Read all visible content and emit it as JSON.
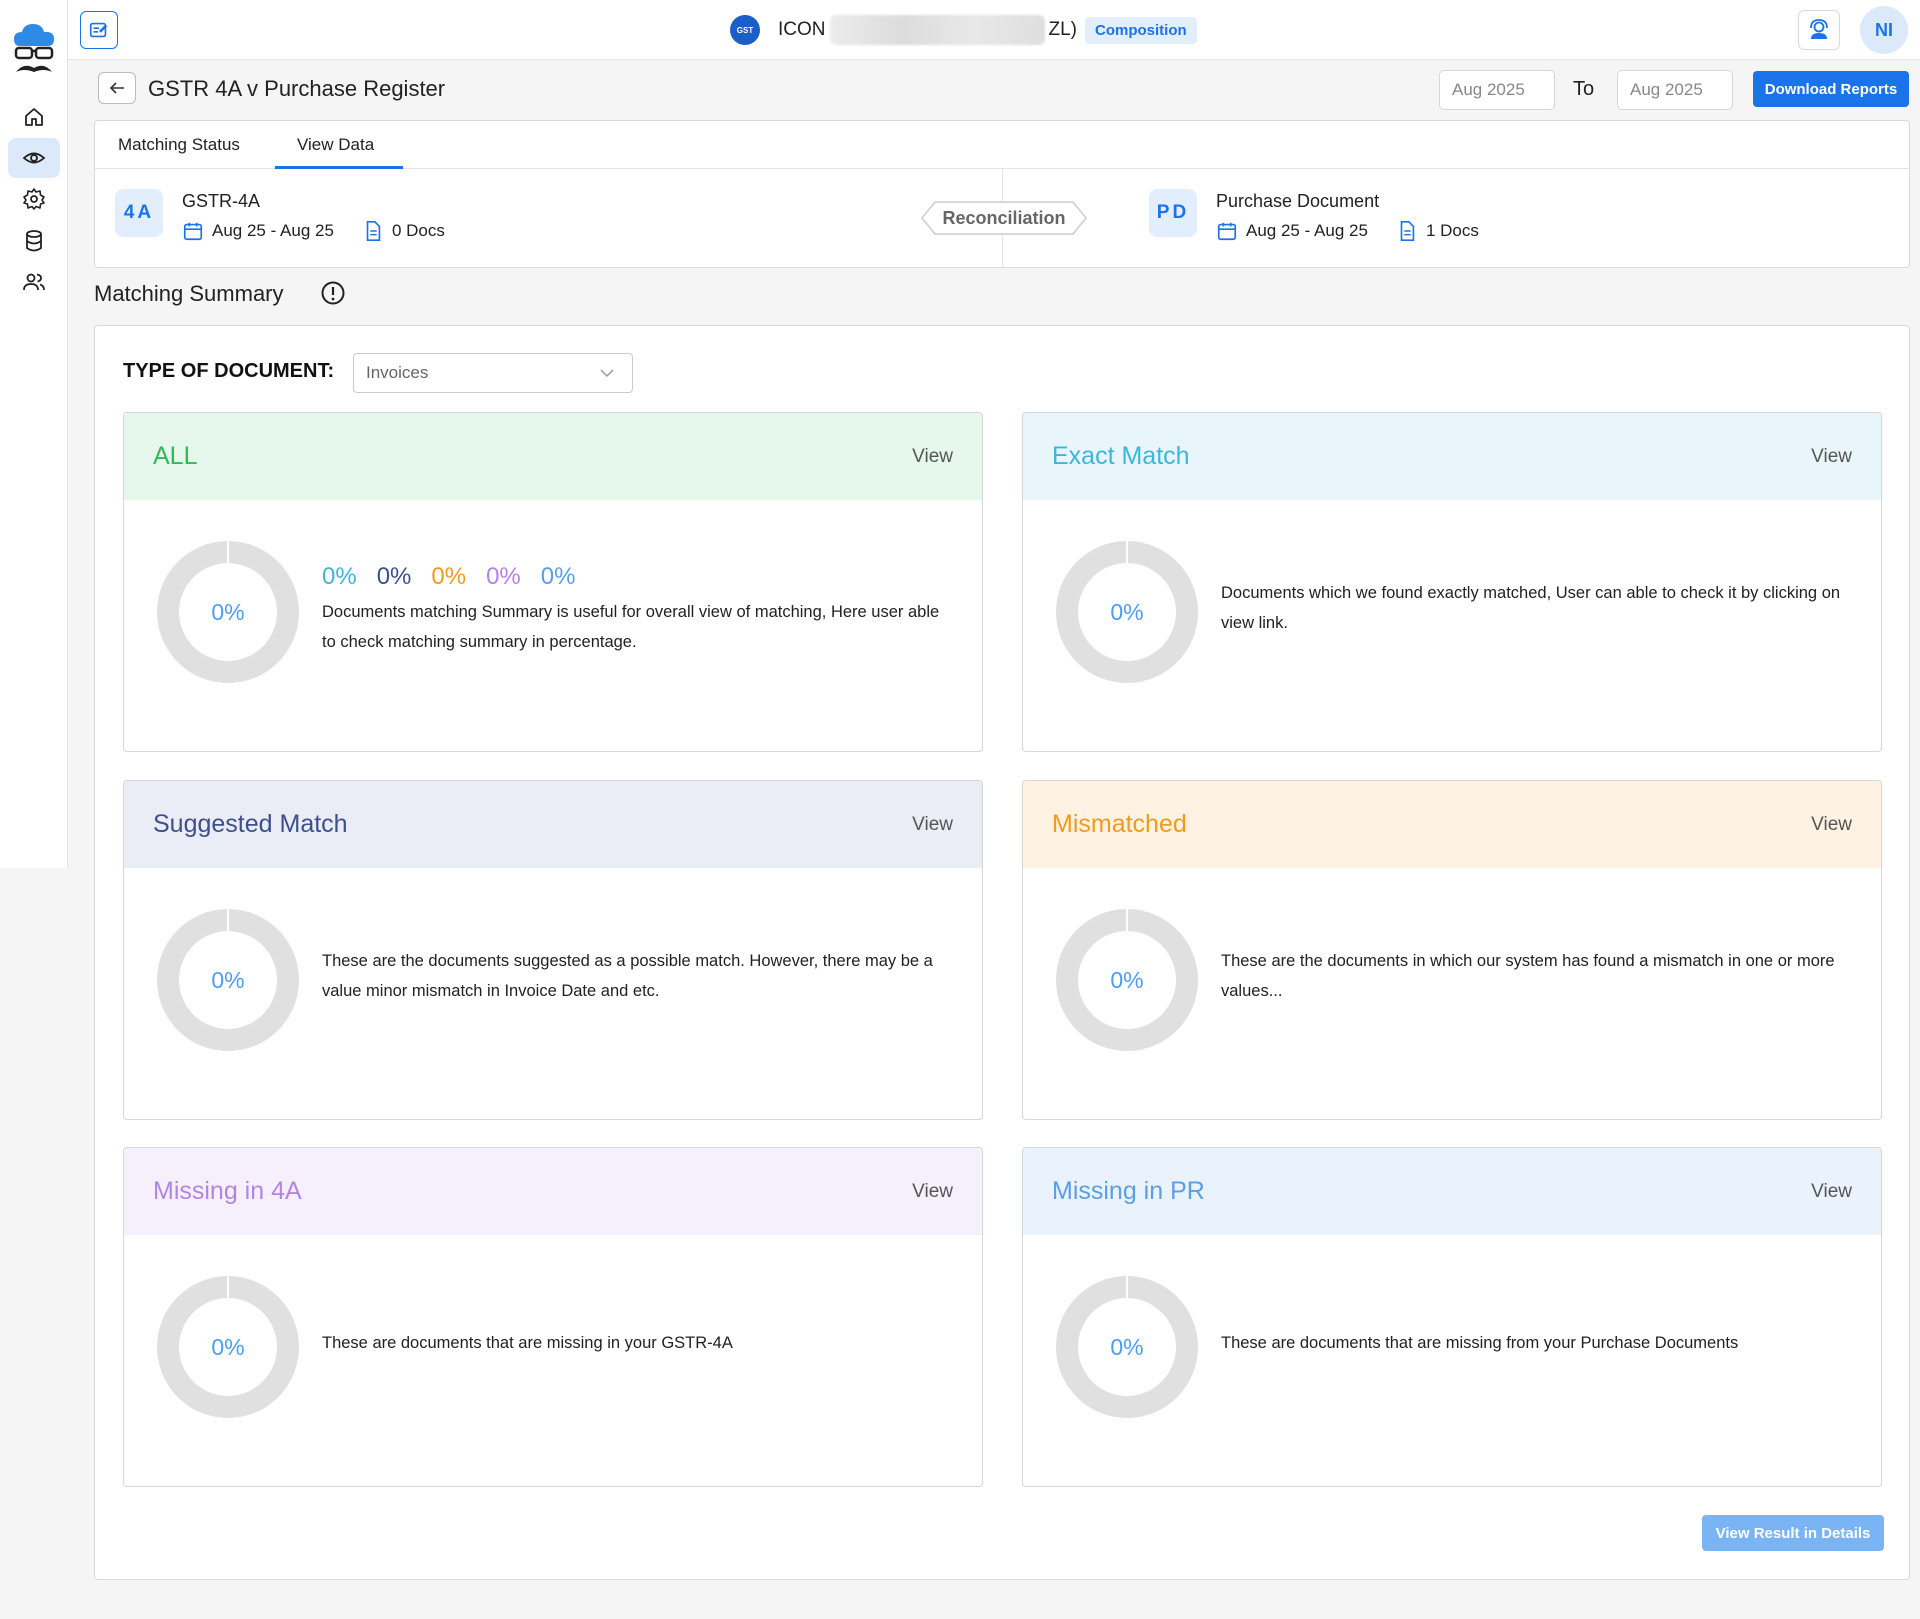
{
  "colors": {
    "accent": "#1a73e8",
    "all": "#2ebb5a",
    "exact": "#3cb6d9",
    "suggested": "#3d4f8c",
    "mismatched": "#f29a1f",
    "missing4a": "#b284e6",
    "missingpr": "#5a9ee6"
  },
  "topbar": {
    "company_prefix": "ICON",
    "company_suffix": "ZL)",
    "company_tag": "Composition",
    "avatar_initials": "NI"
  },
  "header": {
    "title": "GSTR 4A v Purchase Register",
    "from_date": "Aug 2025",
    "to_label": "To",
    "to_date": "Aug 2025",
    "download_label": "Download Reports"
  },
  "tabs": [
    {
      "label": "Matching Status"
    },
    {
      "label": "View Data"
    }
  ],
  "sources": {
    "left": {
      "badge": "4A",
      "title": "GSTR-4A",
      "period": "Aug 25 - Aug 25",
      "docs": "0 Docs"
    },
    "center": "Reconciliation",
    "right": {
      "badge": "PD",
      "title": "Purchase Document",
      "period": "Aug 25 - Aug 25",
      "docs": "1 Docs"
    }
  },
  "summary": {
    "title": "Matching Summary",
    "type_label": "TYPE OF DOCUMENT:",
    "type_value": "Invoices",
    "view_details_label": "View Result in Details"
  },
  "cards": {
    "all": {
      "title": "ALL",
      "view": "View",
      "percent": "0%",
      "pcts": [
        "0%",
        "0%",
        "0%",
        "0%",
        "0%"
      ],
      "desc": "Documents matching Summary is useful for overall view of matching, Here user able to check matching summary in percentage."
    },
    "exact": {
      "title": "Exact Match",
      "view": "View",
      "percent": "0%",
      "desc": "Documents which we found exactly matched, User can able to check it by clicking on view link."
    },
    "suggested": {
      "title": "Suggested Match",
      "view": "View",
      "percent": "0%",
      "desc": "These are the documents suggested as a possible match. However, there may be a value minor mismatch in Invoice Date and etc."
    },
    "mismatched": {
      "title": "Mismatched",
      "view": "View",
      "percent": "0%",
      "desc": "These are the documents in which our system has found a mismatch in one or more values..."
    },
    "missing4a": {
      "title": "Missing in 4A",
      "view": "View",
      "percent": "0%",
      "desc": "These are documents that are missing in your GSTR-4A"
    },
    "missingpr": {
      "title": "Missing in PR",
      "view": "View",
      "percent": "0%",
      "desc": "These are documents that are missing from your Purchase Documents"
    }
  }
}
